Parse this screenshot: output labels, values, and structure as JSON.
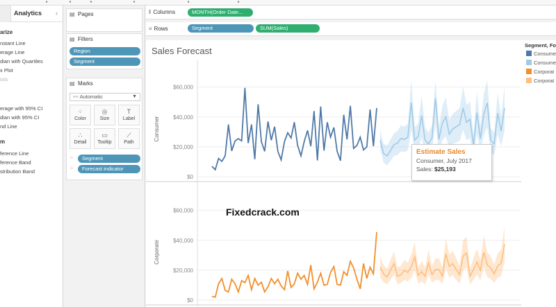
{
  "analytics": {
    "tab_label": "Analytics",
    "collapse_icon": "chevron-left-icon",
    "sections": [
      {
        "head": "arize",
        "top": 34
      },
      {
        "head": "m",
        "top": 192
      }
    ],
    "items": [
      {
        "label": "nstant Line",
        "top": 50,
        "dim": false
      },
      {
        "label": "erage Line",
        "top": 63,
        "dim": false
      },
      {
        "label": "dian with Quartiles",
        "top": 76,
        "dim": false
      },
      {
        "label": "x Plot",
        "top": 89,
        "dim": false
      },
      {
        "label": "tals",
        "top": 102,
        "dim": true
      },
      {
        "label": "erage with 95% CI",
        "top": 144,
        "dim": false
      },
      {
        "label": "dian with 95% CI",
        "top": 157,
        "dim": false
      },
      {
        "label": "nd Line",
        "top": 170,
        "dim": false
      },
      {
        "label": "ference Line",
        "top": 209,
        "dim": false
      },
      {
        "label": "ference Band",
        "top": 222,
        "dim": false
      },
      {
        "label": "stribution Band",
        "top": 235,
        "dim": false
      }
    ]
  },
  "pages": {
    "title": "Pages"
  },
  "filters": {
    "title": "Filters",
    "pills": [
      "Region",
      "Segment"
    ]
  },
  "marks": {
    "title": "Marks",
    "type": "Automatic",
    "buttons": [
      "Color",
      "Size",
      "Label",
      "Detail",
      "Tooltip",
      "Path"
    ],
    "fields": [
      "Segment",
      "Forecast indicator"
    ]
  },
  "columns": {
    "label": "Columns",
    "pill": "MONTH(Order Date..."
  },
  "rows": {
    "label": "Rows",
    "pills": [
      "Segment",
      "SUM(Sales)"
    ]
  },
  "view": {
    "title": "Sales Forecast",
    "watermark": "Fixedcrack.com"
  },
  "legend": {
    "title": "Segment, Fo",
    "items": [
      {
        "label": "Consume",
        "color": "#4e79a7"
      },
      {
        "label": "Consume",
        "color": "#a0cbe8"
      },
      {
        "label": "Corporat",
        "color": "#f28e2b"
      },
      {
        "label": "Corporat",
        "color": "#ffbe7d"
      }
    ]
  },
  "tooltip": {
    "title": "Estimate Sales",
    "line1": "Consumer, July 2017",
    "sales_label": "Sales:",
    "sales_value": "$25,193"
  },
  "chart_data": {
    "type": "line",
    "panes": [
      {
        "row_label": "Consumer",
        "yticks": [
          "$60,000",
          "$40,000",
          "$20,000",
          "$0"
        ],
        "ylim": [
          0,
          64000
        ],
        "actual_color": "#4e79a7",
        "forecast_color": "#a0cbe8",
        "actual": [
          6500,
          4200,
          11800,
          9800,
          13500,
          34500,
          16800,
          23500,
          25000,
          23500,
          59000,
          22000,
          34500,
          11200,
          48000,
          23000,
          16500,
          36500,
          24000,
          33000,
          16500,
          10800,
          23000,
          29000,
          25500,
          36000,
          20500,
          13500,
          23000,
          30500,
          20000,
          43500,
          10500,
          46500,
          17000,
          36000,
          26000,
          32500,
          16500,
          10300,
          41000,
          24500,
          47000,
          18500,
          20500,
          26000,
          17500,
          19500,
          44500,
          20000,
          45500
        ],
        "forecast": [
          24000,
          15000,
          13500,
          17000,
          21000,
          22000,
          25193,
          24500,
          26000,
          49000,
          24000,
          26500,
          40500,
          24000,
          21500,
          25500,
          52000,
          24500,
          35500,
          39500,
          28000,
          31500,
          33000,
          34500,
          45500,
          36000,
          38000,
          20500,
          42500,
          25000,
          41500,
          49000,
          24000,
          21500,
          42000,
          30000,
          45500
        ],
        "band_low": [
          18000,
          9000,
          7000,
          10000,
          13500,
          14000,
          16500,
          16000,
          17000,
          31000,
          16000,
          17500,
          26000,
          15500,
          14000,
          17500,
          34500,
          16500,
          24000,
          26500,
          18500,
          21500,
          22500,
          23500,
          31000,
          24000,
          25500,
          13500,
          28500,
          16500,
          27500,
          32500,
          16000,
          14000,
          28000,
          20000,
          30500
        ],
        "band_high": [
          31000,
          21500,
          20500,
          24500,
          28500,
          30000,
          34000,
          33000,
          35000,
          64000,
          32500,
          35500,
          54000,
          32500,
          29000,
          34000,
          67000,
          33000,
          47000,
          52500,
          37500,
          41500,
          43500,
          45500,
          60000,
          47500,
          50000,
          27500,
          56500,
          33500,
          55000,
          64500,
          32000,
          29000,
          56000,
          40000,
          60000
        ]
      },
      {
        "row_label": "Corporate",
        "yticks": [
          "$60,000",
          "$40,000",
          "$20,000",
          "$0"
        ],
        "ylim": [
          0,
          64000
        ],
        "actual_color": "#f28e2b",
        "forecast_color": "#ffbe7d",
        "actual": [
          2000,
          1500,
          10500,
          14000,
          6000,
          5000,
          13500,
          10500,
          5000,
          12500,
          11200,
          16000,
          6500,
          14000,
          9500,
          11500,
          5000,
          8500,
          14000,
          10500,
          13500,
          9000,
          6500,
          19000,
          8000,
          10500,
          17500,
          13500,
          16000,
          10000,
          23000,
          7000,
          11500,
          17500,
          9500,
          10000,
          18000,
          22000,
          10000,
          9500,
          18500,
          16000,
          25500,
          21000,
          13500,
          7000,
          24000,
          14000,
          21500,
          17000,
          45000
        ],
        "forecast": [
          21500,
          17000,
          15000,
          19500,
          24000,
          15500,
          16500,
          19500,
          18000,
          22000,
          28500,
          16000,
          18500,
          15500,
          24500,
          16500,
          20000,
          20000,
          15500,
          30500,
          22000,
          24000,
          20000,
          16500,
          29000,
          31000,
          15500,
          20000,
          25000,
          19500,
          31500,
          23000,
          21000,
          17000,
          22500,
          24000,
          37000
        ],
        "band_low": [
          14500,
          11500,
          10000,
          13000,
          16500,
          10000,
          11000,
          13000,
          12000,
          14500,
          19500,
          10500,
          12000,
          10000,
          16500,
          11000,
          13000,
          13000,
          10000,
          21000,
          14500,
          16000,
          13000,
          10500,
          19500,
          21000,
          10000,
          13000,
          16500,
          12500,
          21500,
          15000,
          13500,
          11000,
          14500,
          15500,
          25000
        ],
        "band_high": [
          29000,
          23000,
          20500,
          26500,
          32000,
          21500,
          22500,
          26500,
          24500,
          30000,
          38500,
          21500,
          25500,
          21500,
          33000,
          22500,
          27500,
          27500,
          21500,
          41000,
          30000,
          32500,
          27500,
          22500,
          39500,
          42000,
          21000,
          27500,
          34000,
          26500,
          43000,
          31500,
          29000,
          23500,
          31000,
          33000,
          49000
        ]
      }
    ]
  }
}
